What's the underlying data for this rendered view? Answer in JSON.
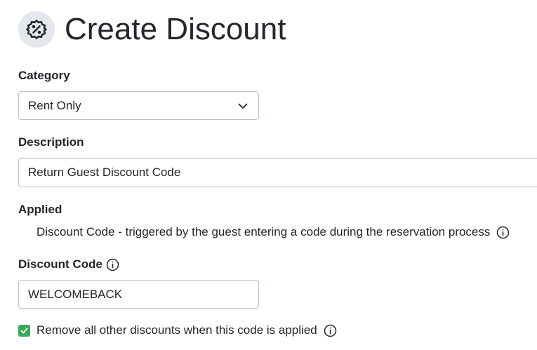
{
  "header": {
    "title": "Create Discount",
    "icon": "discount-badge-icon"
  },
  "category": {
    "label": "Category",
    "selected": "Rent Only"
  },
  "description": {
    "label": "Description",
    "value": "Return Guest Discount Code"
  },
  "applied": {
    "label": "Applied",
    "text": "Discount Code - triggered by the guest entering a code during the reservation process"
  },
  "discount_code": {
    "label": "Discount Code",
    "value": "WELCOMEBACK"
  },
  "remove_others": {
    "label": "Remove all other discounts when this code is applied",
    "checked": true
  },
  "colors": {
    "checkbox": "#39a956",
    "icon_bg": "#e4e7eb",
    "border": "#b9bfc6"
  }
}
